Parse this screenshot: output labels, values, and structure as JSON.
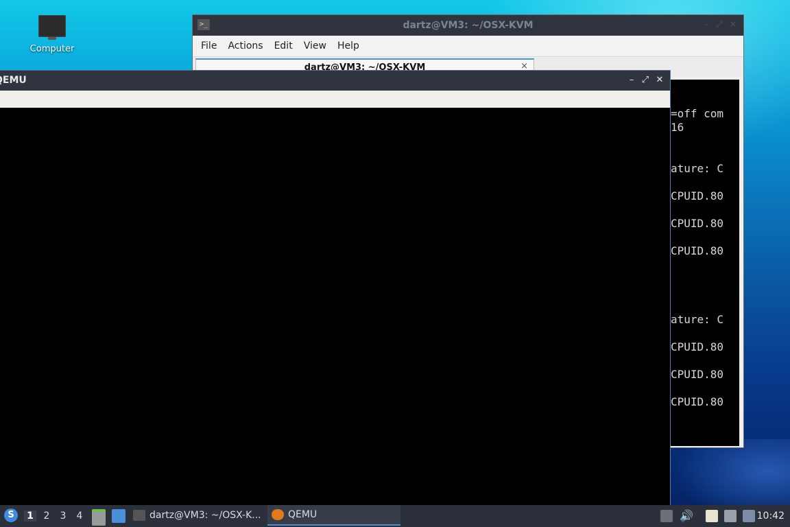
{
  "desktop": {
    "icons": [
      {
        "label": "Computer",
        "icon": "computer-icon"
      }
    ]
  },
  "terminal": {
    "title": "dartz@VM3: ~/OSX-KVM",
    "menu": [
      "File",
      "Actions",
      "Edit",
      "View",
      "Help"
    ],
    "tab_label": "dartz@VM3: ~/OSX-KVM",
    "tab_close": "×",
    "visible_lines": [
      {
        "text": "=off com"
      },
      {
        "text": "16"
      },
      {
        "text": "ature: C"
      },
      {
        "text": "CPUID.80"
      },
      {
        "text": "CPUID.80"
      },
      {
        "text": "CPUID.80"
      },
      {
        "text": "ature: C"
      },
      {
        "text": "CPUID.80"
      },
      {
        "text": "CPUID.80"
      },
      {
        "text": "CPUID.80"
      }
    ]
  },
  "qemu": {
    "title": "QEMU",
    "buttons": {
      "minimize": "–",
      "maximize": "⤢",
      "close": "✕"
    }
  },
  "taskbar": {
    "start_icon": "lxqt-menu-icon",
    "workspaces": [
      "1",
      "2",
      "3",
      "4"
    ],
    "active_workspace": "1",
    "quicklaunch": [
      "file-manager-icon",
      "show-desktop-icon"
    ],
    "tasks": [
      {
        "label": "dartz@VM3: ~/OSX-K...",
        "icon": "terminal-icon",
        "active": false
      },
      {
        "label": "QEMU",
        "icon": "qemu-icon",
        "active": true
      }
    ],
    "tray": [
      "tray-up-icon",
      "volume-icon",
      "clipboard-icon",
      "network-icon",
      "notification-icon"
    ],
    "clock": "10:42"
  },
  "colors": {
    "titlebar": "#2f343f",
    "taskbar": "#2b303b",
    "accent": "#4a90d9"
  }
}
